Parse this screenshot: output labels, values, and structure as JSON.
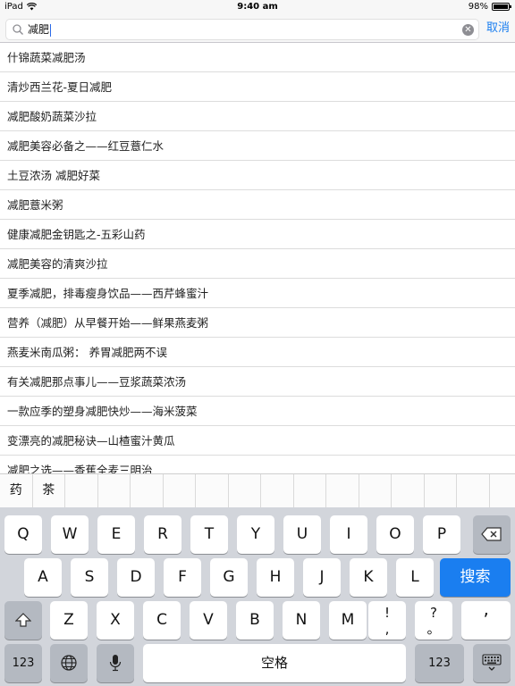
{
  "status": {
    "device": "iPad",
    "time": "9:40 am",
    "battery": "98%",
    "battery_level": 0.98
  },
  "search": {
    "query": "减肥",
    "cancel_label": "取消"
  },
  "results": [
    "什锦蔬菜减肥汤",
    "清炒西兰花-夏日减肥",
    "减肥酸奶蔬菜沙拉",
    "减肥美容必备之——红豆薏仁水",
    "土豆浓汤 减肥好菜",
    "减肥薏米粥",
    "健康减肥金钥匙之-五彩山药",
    "减肥美容的清爽沙拉",
    "夏季减肥，排毒瘦身饮品——西芹蜂蜜汁",
    "营养（减肥）从早餐开始——鲜果燕麦粥",
    "燕麦米南瓜粥： 养胃减肥两不误",
    "有关减肥那点事儿——豆浆蔬菜浓汤",
    "一款应季的塑身减肥快炒——海米菠菜",
    "变漂亮的减肥秘诀—山楂蜜汁黄瓜",
    "减肥之选——香蕉全麦三明治"
  ],
  "candidates": [
    "药",
    "茶"
  ],
  "keyboard": {
    "row1": [
      "Q",
      "W",
      "E",
      "R",
      "T",
      "Y",
      "U",
      "I",
      "O",
      "P"
    ],
    "row2": [
      "A",
      "S",
      "D",
      "F",
      "G",
      "H",
      "J",
      "K",
      "L"
    ],
    "search_key": "搜索",
    "row3": [
      "Z",
      "X",
      "C",
      "V",
      "B",
      "N",
      "M"
    ],
    "punct1": [
      "!",
      ","
    ],
    "punct2": [
      "?",
      "。"
    ],
    "apostrophe": "’",
    "numbers_key": "123",
    "space_key": "空格"
  },
  "colors": {
    "accent": "#1a7ef0",
    "keyboard_bg": "#d2d5db"
  }
}
